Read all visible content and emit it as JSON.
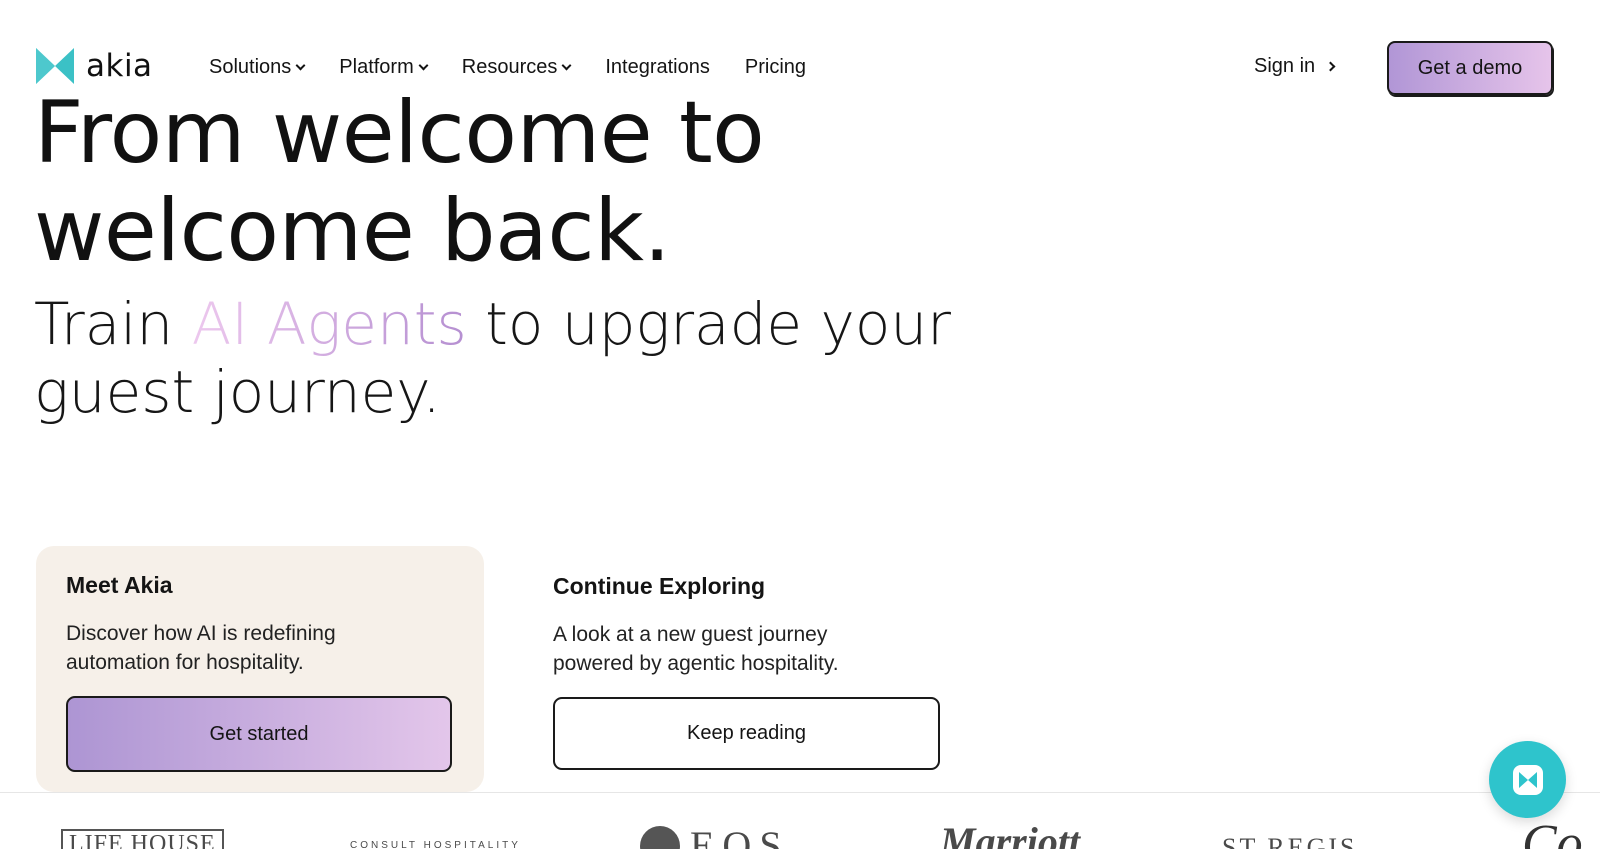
{
  "brand": {
    "name": "akia",
    "logo_icon": "akia-bowtie-logo",
    "colors": {
      "teal": "#3bc1c6",
      "purple": "#b196d6",
      "pink": "#e6c4ea",
      "beige": "#f6f0e9"
    }
  },
  "nav": {
    "items": [
      {
        "label": "Solutions",
        "dropdown": true
      },
      {
        "label": "Platform",
        "dropdown": true
      },
      {
        "label": "Resources",
        "dropdown": true
      },
      {
        "label": "Integrations",
        "dropdown": false
      },
      {
        "label": "Pricing",
        "dropdown": false
      }
    ],
    "signin_label": "Sign in",
    "demo_label": "Get a demo"
  },
  "hero": {
    "title_line1": "From welcome to",
    "title_line2": "welcome back.",
    "sub_pre": "Train ",
    "sub_highlight": "AI Agents",
    "sub_post": " to upgrade your guest journey."
  },
  "cards": {
    "meet": {
      "title": "Meet Akia",
      "description": "Discover how AI is redefining automation for hospitality.",
      "button": "Get started"
    },
    "explore": {
      "title": "Continue Exploring",
      "description": "A look at a new guest journey powered by agentic hospitality.",
      "button": "Keep reading"
    }
  },
  "partner_logos": [
    {
      "name": "LIFE HOUSE"
    },
    {
      "name": "CONSULT HOSPITALITY"
    },
    {
      "name": "EOS"
    },
    {
      "name": "Marriott"
    },
    {
      "name": "ST REGIS"
    },
    {
      "name": "Co"
    }
  ],
  "chat": {
    "icon": "chat-bowtie-icon"
  }
}
